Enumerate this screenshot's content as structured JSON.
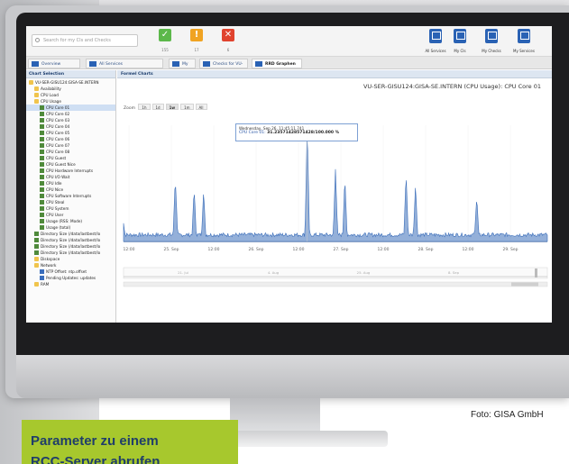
{
  "app": {
    "search_placeholder": "Search for my CIs and Checks"
  },
  "status_buttons": [
    {
      "label": "✓",
      "count": "155",
      "color": "#5cb84a"
    },
    {
      "label": "!",
      "count": "17",
      "color": "#f0a322"
    },
    {
      "label": "✕",
      "count": "6",
      "color": "#e0432e"
    }
  ],
  "tools": [
    {
      "label": "All Services",
      "icon": "services-icon"
    },
    {
      "label": "My CIs",
      "icon": "monitor-icon"
    },
    {
      "label": "My Checks",
      "icon": "chart-icon"
    },
    {
      "label": "My Services",
      "icon": "services-list-icon"
    }
  ],
  "tabs": [
    {
      "label": "Overview"
    },
    {
      "label": "All Services"
    },
    {
      "label": "My CIs"
    },
    {
      "label": "Checks for VU-SER"
    },
    {
      "label": "RRD Graphen"
    }
  ],
  "sidebar": {
    "title": "Chart Selection",
    "items": [
      {
        "label": "VU-SER-GISU124:GISA-SE.INTERN",
        "icon": "folder",
        "indent": 0
      },
      {
        "label": "Availability",
        "icon": "folder",
        "indent": 1
      },
      {
        "label": "CPU Load",
        "icon": "folder",
        "indent": 1
      },
      {
        "label": "CPU Usage",
        "icon": "folder",
        "indent": 1
      },
      {
        "label": "CPU Core 01",
        "icon": "chart",
        "indent": 2,
        "selected": true
      },
      {
        "label": "CPU Core 02",
        "icon": "chart",
        "indent": 2
      },
      {
        "label": "CPU Core 03",
        "icon": "chart",
        "indent": 2
      },
      {
        "label": "CPU Core 04",
        "icon": "chart",
        "indent": 2
      },
      {
        "label": "CPU Core 05",
        "icon": "chart",
        "indent": 2
      },
      {
        "label": "CPU Core 06",
        "icon": "chart",
        "indent": 2
      },
      {
        "label": "CPU Core 07",
        "icon": "chart",
        "indent": 2
      },
      {
        "label": "CPU Core 08",
        "icon": "chart",
        "indent": 2
      },
      {
        "label": "CPU Guest",
        "icon": "chart",
        "indent": 2
      },
      {
        "label": "CPU Guest Nice",
        "icon": "chart",
        "indent": 2
      },
      {
        "label": "CPU Hardware Interrupts",
        "icon": "chart",
        "indent": 2
      },
      {
        "label": "CPU I/O Wait",
        "icon": "chart",
        "indent": 2
      },
      {
        "label": "CPU Idle",
        "icon": "chart",
        "indent": 2
      },
      {
        "label": "CPU Nice",
        "icon": "chart",
        "indent": 2
      },
      {
        "label": "CPU Software Interrupts",
        "icon": "chart",
        "indent": 2
      },
      {
        "label": "CPU Steal",
        "icon": "chart",
        "indent": 2
      },
      {
        "label": "CPU System",
        "icon": "chart",
        "indent": 2
      },
      {
        "label": "CPU User",
        "icon": "chart",
        "indent": 2
      },
      {
        "label": "Usage (RSS: Mode)",
        "icon": "chart",
        "indent": 2
      },
      {
        "label": "Usage (total)",
        "icon": "chart",
        "indent": 2
      },
      {
        "label": "Directory Size (/data/lastbest/lo",
        "icon": "chart",
        "indent": 1
      },
      {
        "label": "Directory Size (/data/lastbest/lo",
        "icon": "chart",
        "indent": 1
      },
      {
        "label": "Directory Size (/data/lastbest/lo",
        "icon": "chart",
        "indent": 1
      },
      {
        "label": "Directory Size (/data/lastbest/lo",
        "icon": "chart",
        "indent": 1
      },
      {
        "label": "Diskspace",
        "icon": "folder",
        "indent": 1
      },
      {
        "label": "Network",
        "icon": "folder",
        "indent": 1
      },
      {
        "label": "NTP Offset: ntp.offset",
        "icon": "net",
        "indent": 2
      },
      {
        "label": "Pending Updates: updates",
        "icon": "net",
        "indent": 2
      },
      {
        "label": "RAM",
        "icon": "folder",
        "indent": 1
      }
    ]
  },
  "main": {
    "panel_title": "Formel Charts",
    "chart_title": "VU-SER-GISU124:GISA-SE.INTERN (CPU Usage): CPU Core 01",
    "zoom_label": "Zoom",
    "zoom_options": [
      "1h",
      "1d",
      "1w",
      "1m",
      "All"
    ],
    "zoom_active": "1w"
  },
  "tooltip": {
    "line1": "Wednesday, Sep 26, 11:45:11.741",
    "series": "CPU Core 01:",
    "value": "31.23571428571428/100.000 %"
  },
  "chart_data": {
    "type": "area",
    "title": "VU-SER-GISU124:GISA-SE.INTERN (CPU Usage): CPU Core 01",
    "xlabel": "",
    "ylabel": "",
    "color": "#3d6fba",
    "x_ticks": [
      "12:00",
      "25. Sep",
      "12:00",
      "26. Sep",
      "12:00",
      "27. Sep",
      "12:00",
      "28. Sep",
      "12:00",
      "29. Sep"
    ],
    "baseline": 4,
    "spikes": [
      {
        "x_day": 0.0,
        "value": 14
      },
      {
        "x_day": 0.55,
        "value": 55
      },
      {
        "x_day": 0.75,
        "value": 45
      },
      {
        "x_day": 0.85,
        "value": 42
      },
      {
        "x_day": 1.95,
        "value": 99
      },
      {
        "x_day": 2.25,
        "value": 62
      },
      {
        "x_day": 2.35,
        "value": 54
      },
      {
        "x_day": 3.0,
        "value": 58
      },
      {
        "x_day": 3.1,
        "value": 49
      },
      {
        "x_day": 3.75,
        "value": 38
      }
    ],
    "ylim": [
      0,
      100
    ],
    "navigator_labels": [
      "21. Jul",
      "4. Aug",
      "25. Aug",
      "8. Sep"
    ]
  },
  "caption": "Foto: GISA GmbH",
  "callout": {
    "line1": "Parameter zu einem",
    "line2": "RCC-Server abrufen"
  }
}
